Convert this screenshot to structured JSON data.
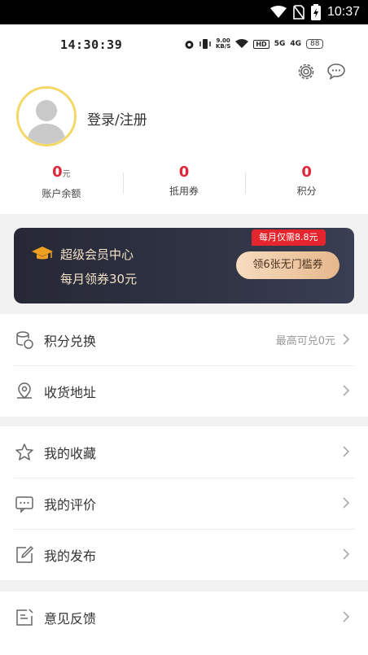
{
  "system_bar": {
    "time": "10:37"
  },
  "inner_status": {
    "time": "14:30:39",
    "net_speed_top": "9.00",
    "net_speed_bottom": "KB/S",
    "hd": "HD",
    "sig1": "5G",
    "sig2": "4G",
    "battery": "88"
  },
  "profile": {
    "login_text": "登录/注册"
  },
  "stats": [
    {
      "value": "0",
      "unit": "元",
      "label": "账户余额"
    },
    {
      "value": "0",
      "unit": "",
      "label": "抵用券"
    },
    {
      "value": "0",
      "unit": "",
      "label": "积分"
    }
  ],
  "vip": {
    "title": "超级会员中心",
    "subtitle": "每月领券30元",
    "price_badge": "每月仅需8.8元",
    "button": "领6张无门槛券"
  },
  "menu": {
    "group1": [
      {
        "label": "积分兑换",
        "value": "最高可兑0元"
      },
      {
        "label": "收货地址",
        "value": ""
      }
    ],
    "group2": [
      {
        "label": "我的收藏"
      },
      {
        "label": "我的评价"
      },
      {
        "label": "我的发布"
      }
    ],
    "group3": [
      {
        "label": "意见反馈"
      }
    ]
  },
  "colors": {
    "accent_red": "#e0263b",
    "vip_bg": "#2b2e3d",
    "vip_gold": "#f3e2c7",
    "avatar_border": "#f3d866"
  }
}
